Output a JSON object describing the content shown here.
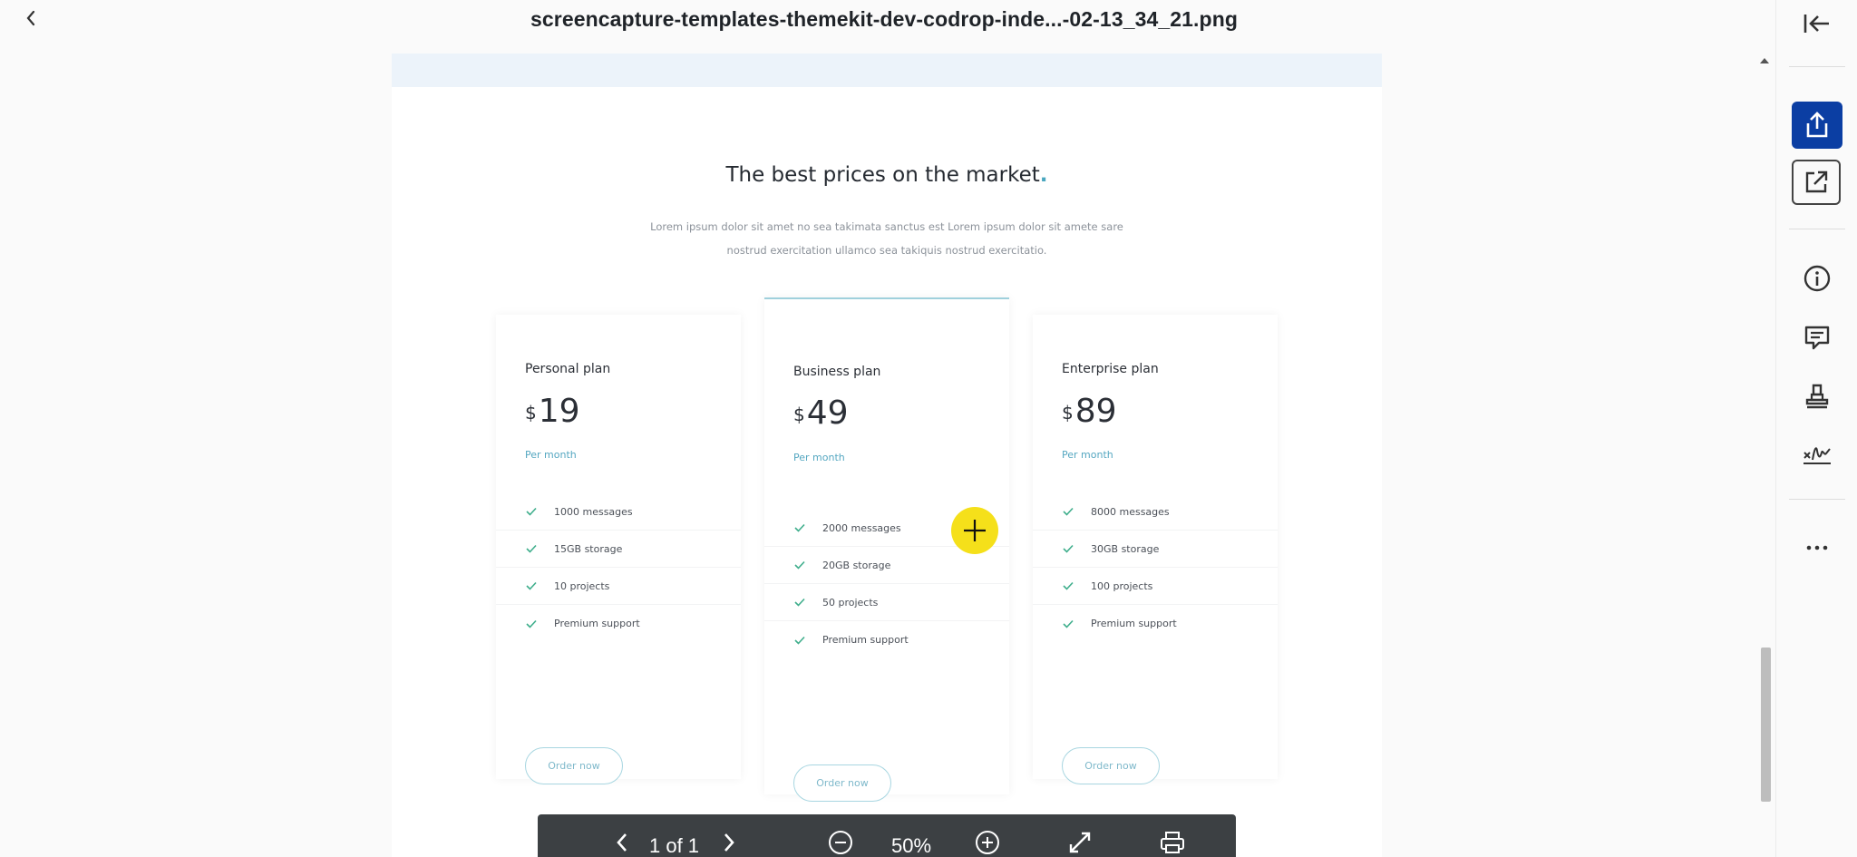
{
  "header": {
    "title": "screencapture-templates-themekit-dev-codrop-inde...-02-13_34_21.png"
  },
  "document": {
    "heading": "The best prices on the market",
    "heading_dot": ".",
    "subtitle_line1": "Lorem ipsum dolor sit amet no sea takimata sanctus est Lorem ipsum dolor sit amete sare",
    "subtitle_line2": "nostrud exercitation ullamco sea takiquis nostrud exercitatio.",
    "plans": [
      {
        "name": "Personal plan",
        "currency": "$",
        "price": "19",
        "period": "Per month",
        "features": [
          "1000 messages",
          "15GB storage",
          "10 projects",
          "Premium support"
        ],
        "button": "Order now"
      },
      {
        "name": "Business plan",
        "currency": "$",
        "price": "49",
        "period": "Per month",
        "features": [
          "2000 messages",
          "20GB storage",
          "50 projects",
          "Premium support"
        ],
        "button": "Order now"
      },
      {
        "name": "Enterprise plan",
        "currency": "$",
        "price": "89",
        "period": "Per month",
        "features": [
          "8000 messages",
          "30GB storage",
          "100 projects",
          "Premium support"
        ],
        "button": "Order now"
      }
    ]
  },
  "toolbar": {
    "page_indicator": "1 of 1",
    "zoom": "50%"
  },
  "rail": {
    "icons": [
      "collapse-panel-icon",
      "share-icon",
      "open-external-icon",
      "info-icon",
      "comment-icon",
      "stamp-icon",
      "signature-icon",
      "more-icon"
    ]
  },
  "colors": {
    "accent": "#0b3ea3",
    "teal": "#4aa7bf",
    "check_green": "#3fae8c",
    "toolbar_bg": "#3c4043",
    "cursor_highlight": "#f5e01a"
  }
}
